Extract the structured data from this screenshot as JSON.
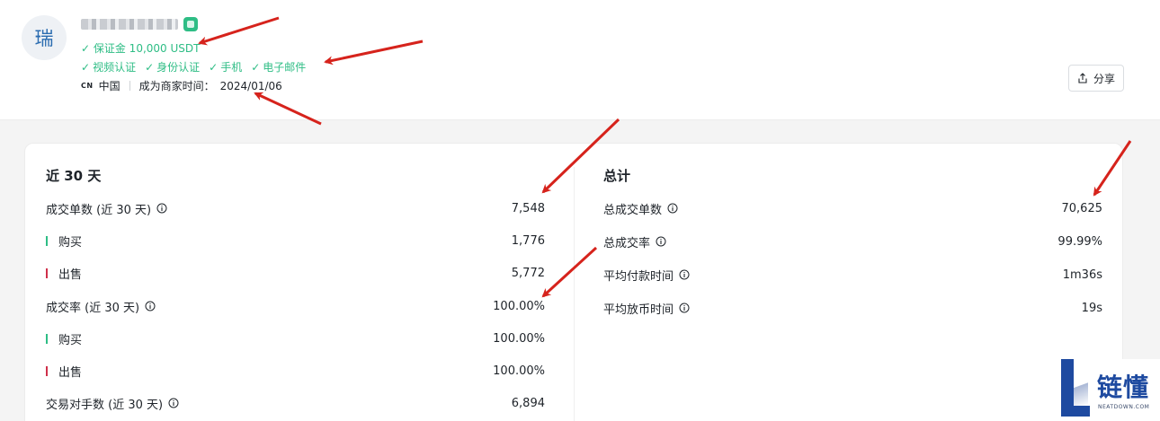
{
  "merchant": {
    "avatar_char": "瑞",
    "name": "",
    "deposit": "✓ 保证金 10,000 USDT",
    "verifications": [
      {
        "check": "✓",
        "label": "视频认证"
      },
      {
        "check": "✓",
        "label": "身份认证"
      },
      {
        "check": "✓",
        "label": "手机"
      },
      {
        "check": "✓",
        "label": "电子邮件"
      }
    ],
    "country_code": "CN",
    "country": "中国",
    "since_label": "成为商家时间：",
    "since_date": "2024/01/06"
  },
  "share_button": {
    "label": "分享"
  },
  "last30": {
    "title": "近 30 天",
    "rows": [
      {
        "label": "成交单数 (近 30 天)",
        "value": "7,548"
      },
      {
        "label": "购买",
        "value": "1,776"
      },
      {
        "label": "出售",
        "value": "5,772"
      },
      {
        "label": "成交率 (近 30 天)",
        "value": "100.00%"
      },
      {
        "label": "购买",
        "value": "100.00%"
      },
      {
        "label": "出售",
        "value": "100.00%"
      },
      {
        "label": "交易对手数 (近 30 天)",
        "value": "6,894"
      }
    ]
  },
  "total": {
    "title": "总计",
    "rows": [
      {
        "label": "总成交单数",
        "value": "70,625"
      },
      {
        "label": "总成交率",
        "value": "99.99%"
      },
      {
        "label": "平均付款时间",
        "value": "1m36s"
      },
      {
        "label": "平均放币时间",
        "value": "19s"
      }
    ]
  },
  "watermark": {
    "cn": "链懂",
    "en": "NEATDOWN.COM"
  },
  "colors": {
    "positive": "#2ebd85",
    "negative": "#cf304a",
    "annotation": "#d6231c"
  }
}
